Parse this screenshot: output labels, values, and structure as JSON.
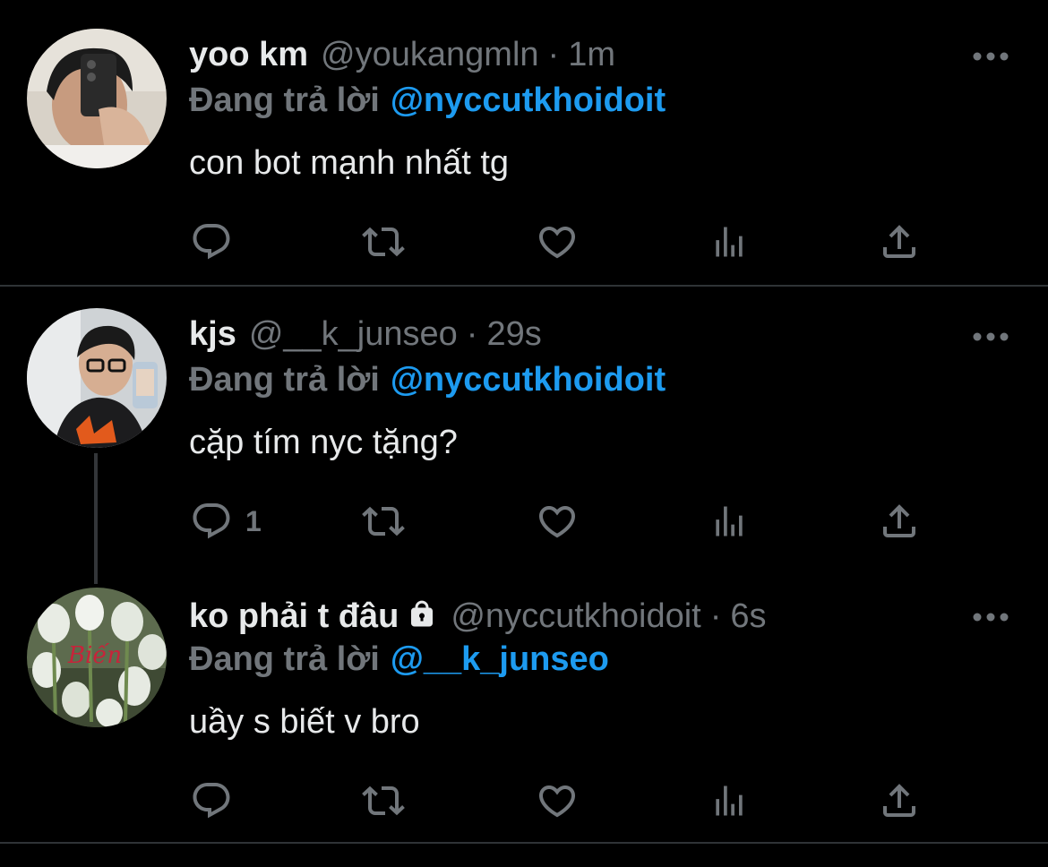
{
  "reply_prefix": "Đang trả lời",
  "tweets": [
    {
      "name": "yoo km",
      "handle": "@youkangmln",
      "separator": "·",
      "time": "1m",
      "reply_to": "@nyccutkhoidoit",
      "text": "con bot mạnh nhất tg",
      "reply_count": "",
      "locked": false
    },
    {
      "name": "kjs",
      "handle": "@__k_junseo",
      "separator": "·",
      "time": "29s",
      "reply_to": "@nyccutkhoidoit",
      "text": "cặp tím nyc tặng?",
      "reply_count": "1",
      "locked": false
    },
    {
      "name": "ko phải t đâu",
      "handle": "@nyccutkhoidoit",
      "separator": "·",
      "time": "6s",
      "reply_to": "@__k_junseo",
      "text": "uầy s biết v bro",
      "reply_count": "",
      "locked": true,
      "avatar_text": "Biến"
    }
  ],
  "icons": {
    "reply": "reply-icon",
    "retweet": "retweet-icon",
    "like": "heart-icon",
    "analytics": "analytics-icon",
    "share": "share-icon",
    "more": "more-icon",
    "lock": "lock-icon"
  },
  "colors": {
    "background": "#000000",
    "text": "#e7e9ea",
    "muted": "#71767b",
    "link": "#1d9bf0",
    "divider": "#2f3336"
  }
}
